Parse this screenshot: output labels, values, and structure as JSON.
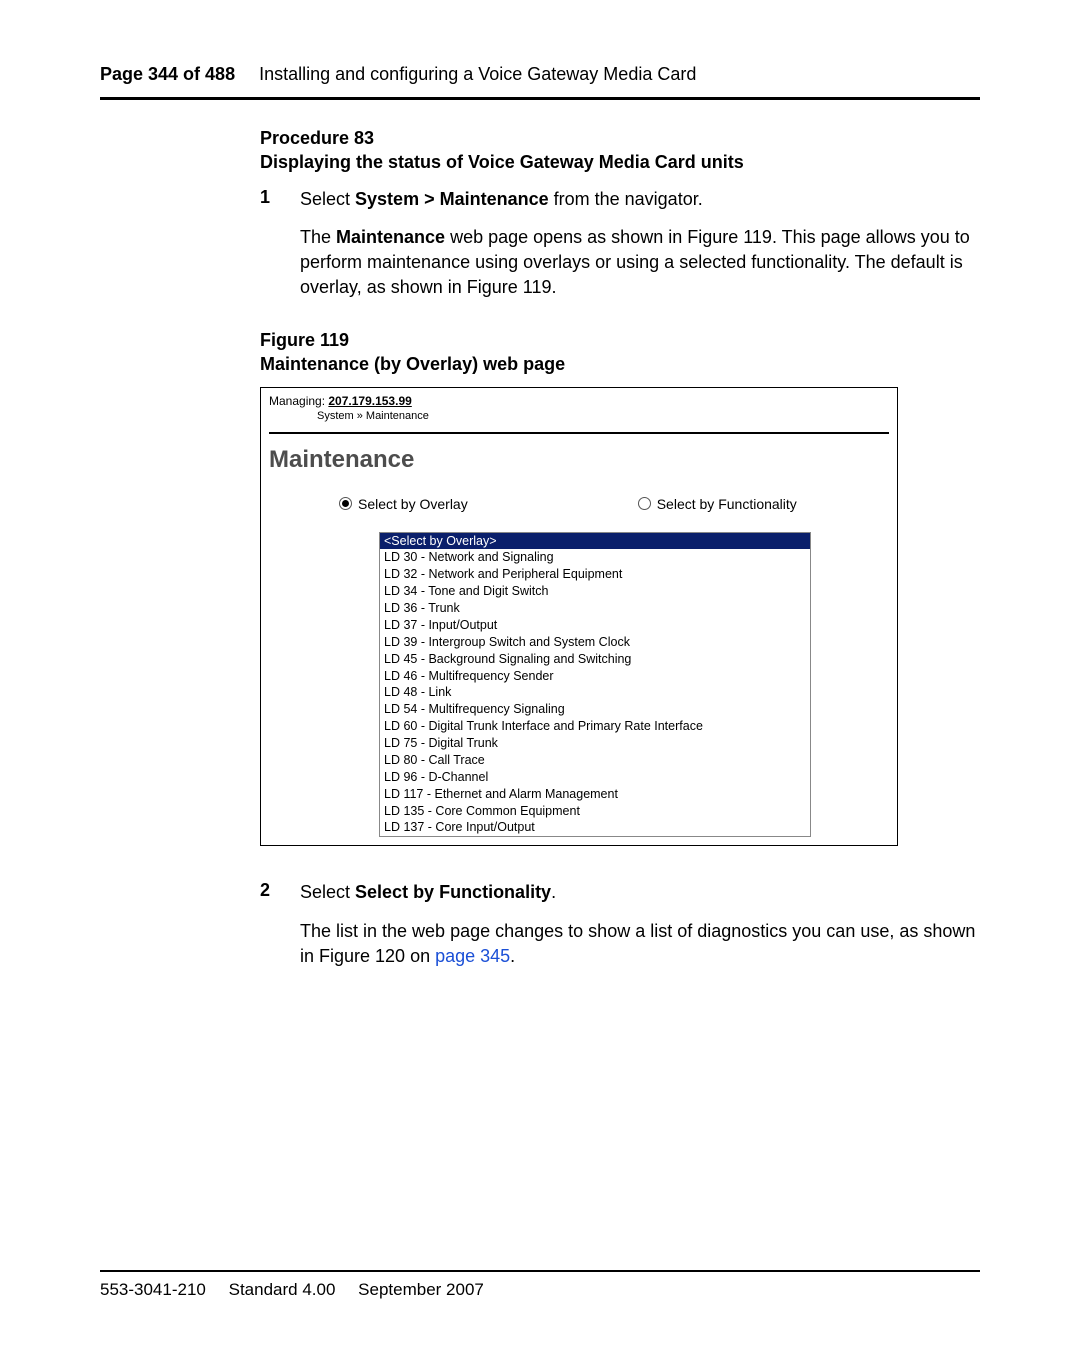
{
  "header": {
    "page_label": "Page 344 of 488",
    "chapter_title": "Installing and configuring a Voice Gateway Media Card"
  },
  "procedure": {
    "label": "Procedure 83",
    "title": "Displaying the status of Voice Gateway Media Card units"
  },
  "step1": {
    "num": "1",
    "pre": "Select ",
    "bold1": "System > Maintenance",
    "post1": " from the navigator.",
    "para2a": "The ",
    "bold2": "Maintenance",
    "para2b": " web page opens as shown in Figure 119. This page allows you to perform maintenance using overlays or using a selected functionality. The default is overlay, as shown in Figure 119."
  },
  "figure": {
    "label": "Figure 119",
    "title": "Maintenance (by Overlay) web page",
    "managing_label": "Managing: ",
    "managing_ip": "207.179.153.99",
    "breadcrumb": "System » Maintenance",
    "heading": "Maintenance",
    "radio_overlay": "Select by Overlay",
    "radio_functionality": "Select by Functionality",
    "options": [
      "<Select by Overlay>",
      "LD 30  - Network and Signaling",
      "LD 32  - Network and Peripheral Equipment",
      "LD 34  - Tone and Digit Switch",
      "LD 36  - Trunk",
      "LD 37  - Input/Output",
      "LD 39  - Intergroup Switch and System Clock",
      "LD 45  - Background Signaling and Switching",
      "LD 46  - Multifrequency Sender",
      "LD 48  - Link",
      "LD 54  - Multifrequency Signaling",
      "LD 60  - Digital Trunk Interface and Primary Rate Interface",
      "LD 75  - Digital Trunk",
      "LD 80  - Call Trace",
      "LD 96  - D-Channel",
      "LD 117 - Ethernet and Alarm Management",
      "LD 135 - Core Common Equipment",
      "LD 137 - Core Input/Output"
    ]
  },
  "step2": {
    "num": "2",
    "pre": "Select ",
    "bold": "Select by Functionality",
    "post": ".",
    "para2a": "The list in the web page changes to show a list of diagnostics you can use, as shown in Figure 120 on ",
    "link": "page 345",
    "para2b": "."
  },
  "footer": {
    "docnum": "553-3041-210",
    "standard": "Standard 4.00",
    "date": "September 2007"
  }
}
